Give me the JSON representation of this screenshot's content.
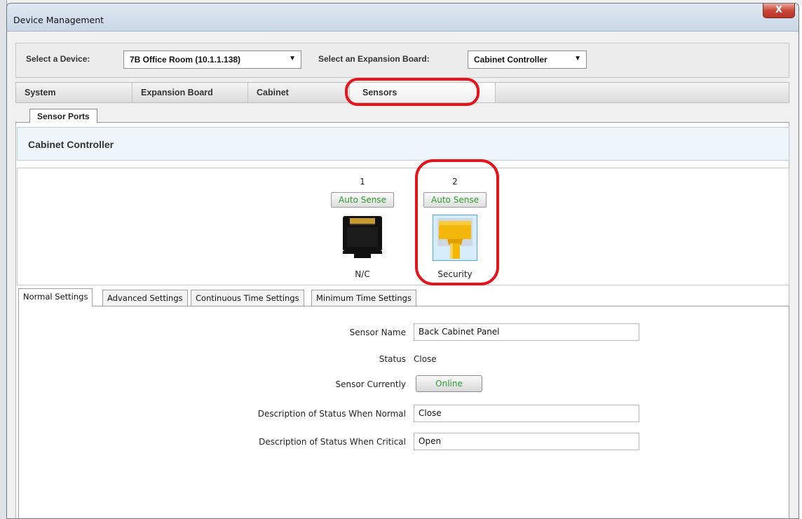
{
  "window": {
    "title": "Device Management",
    "close_label": "X"
  },
  "device_row": {
    "device_label": "Select a Device:",
    "device_value": "7B Office Room (10.1.1.138)",
    "board_label": "Select an Expansion Board:",
    "board_value": "Cabinet Controller"
  },
  "tabs": [
    {
      "label": "System"
    },
    {
      "label": "Expansion Board"
    },
    {
      "label": "Cabinet"
    },
    {
      "label": "Sensors"
    }
  ],
  "subtab": {
    "label": "Sensor Ports"
  },
  "section": {
    "title": "Cabinet Controller"
  },
  "ports": [
    {
      "number": "1",
      "button": "Auto Sense",
      "label": "N/C",
      "icon": "ethernet-port-empty-icon"
    },
    {
      "number": "2",
      "button": "Auto Sense",
      "label": "Security",
      "icon": "ethernet-port-connected-icon"
    }
  ],
  "settings_tabs": [
    {
      "label": "Normal Settings"
    },
    {
      "label": "Advanced Settings"
    },
    {
      "label": "Continuous Time Settings"
    },
    {
      "label": "Minimum Time Settings"
    }
  ],
  "form": {
    "sensor_name_label": "Sensor Name",
    "sensor_name_value": "Back Cabinet Panel",
    "status_label": "Status",
    "status_value": "Close",
    "currently_label": "Sensor Currently",
    "currently_button": "Online",
    "normal_label": "Description of Status When Normal",
    "normal_value": "Close",
    "critical_label": "Description of Status When Critical",
    "critical_value": "Open"
  },
  "colors": {
    "highlight_ring": "#e8121a",
    "online_text": "#2e9a2e",
    "connector_yellow": "#f2b705"
  }
}
